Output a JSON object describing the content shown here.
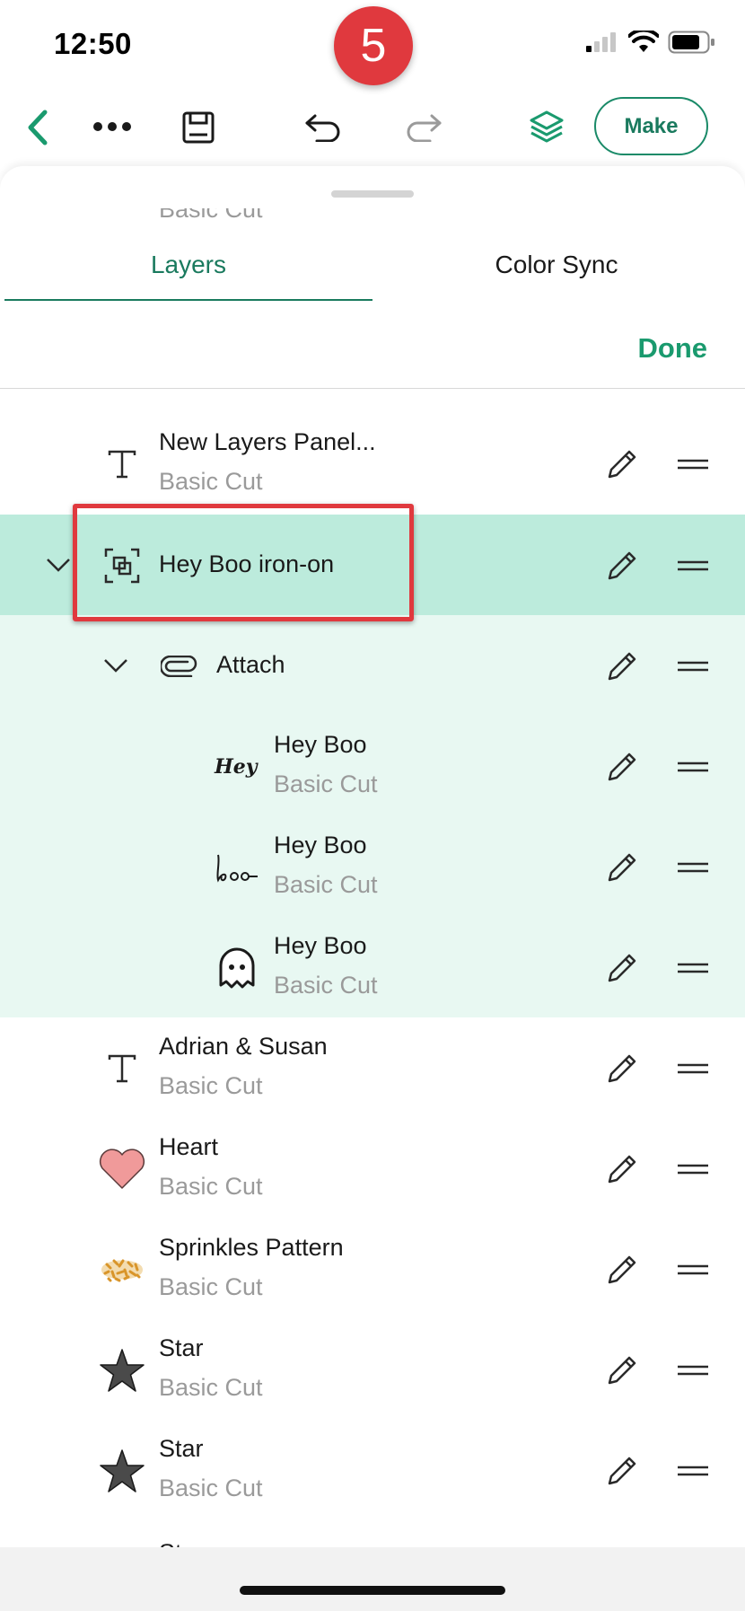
{
  "status_bar": {
    "time": "12:50",
    "step_number": "5",
    "icons": [
      "cellular-signal-icon",
      "wifi-icon",
      "battery-icon"
    ]
  },
  "toolbar": {
    "back_icon": "chevron-left-icon",
    "more_icon": "more-horizontal-icon",
    "save_icon": "save-icon",
    "undo_icon": "undo-icon",
    "redo_icon": "redo-icon",
    "layers_icon": "layers-icon",
    "make_label": "Make"
  },
  "panel": {
    "tabs": [
      {
        "label": "Layers",
        "active": true
      },
      {
        "label": "Color Sync",
        "active": false
      }
    ],
    "done_label": "Done",
    "partial_top_label": "Basic Cut",
    "layers": [
      {
        "name": "New Layers Panel...",
        "sub": "Basic Cut",
        "icon": "text-icon"
      },
      {
        "name": "Hey Boo iron-on",
        "sub": "",
        "icon": "group-icon",
        "expanded": true,
        "selected": true
      },
      {
        "name": "Attach",
        "sub": "",
        "icon": "attach-icon",
        "expanded": true
      },
      {
        "name": "Hey Boo",
        "sub": "Basic Cut",
        "icon": "hey-script-icon"
      },
      {
        "name": "Hey Boo",
        "sub": "Basic Cut",
        "icon": "boo-script-icon"
      },
      {
        "name": "Hey Boo",
        "sub": "Basic Cut",
        "icon": "ghost-icon"
      },
      {
        "name": "Adrian & Susan",
        "sub": "Basic Cut",
        "icon": "text-icon"
      },
      {
        "name": "Heart",
        "sub": "Basic Cut",
        "icon": "heart-icon"
      },
      {
        "name": "Sprinkles Pattern",
        "sub": "Basic Cut",
        "icon": "sprinkles-pattern-icon"
      },
      {
        "name": "Star",
        "sub": "Basic Cut",
        "icon": "star-icon"
      },
      {
        "name": "Star",
        "sub": "Basic Cut",
        "icon": "star-icon"
      }
    ],
    "partial_bottom_label": "Star"
  },
  "colors": {
    "accent": "#1a7a5e",
    "done": "#1a9a6e",
    "selected_row": "#bcebdc",
    "child_row": "#e8f8f2",
    "highlight": "#e0393e",
    "heart_fill": "#f09a9a",
    "sprinkles": "#d9952a"
  }
}
